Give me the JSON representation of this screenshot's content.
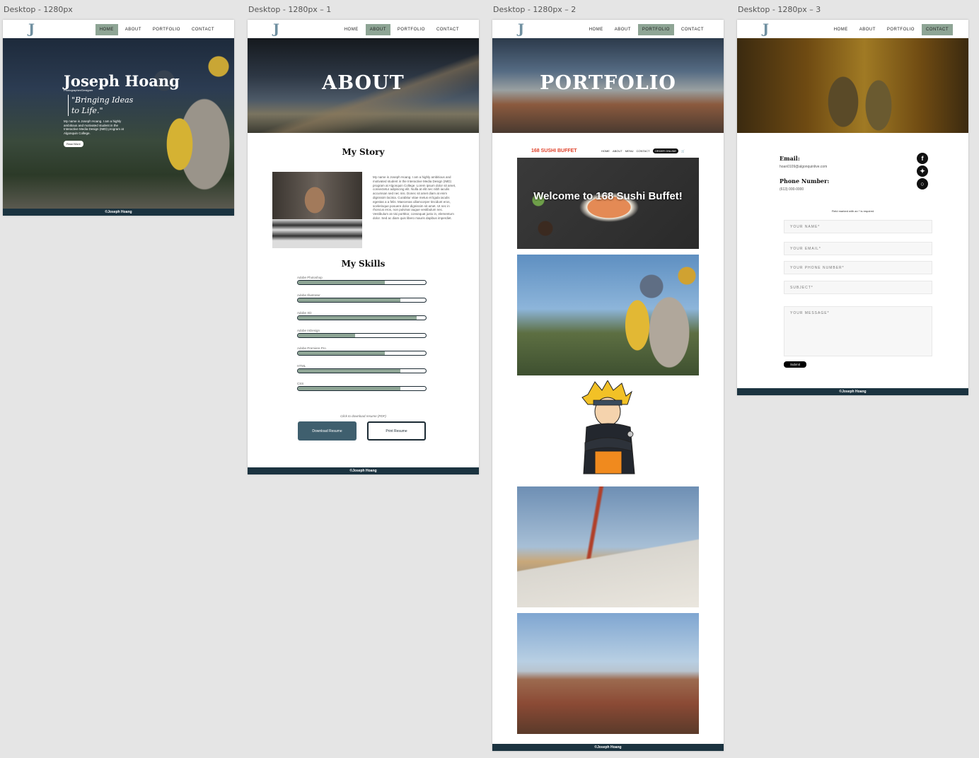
{
  "artboards": [
    {
      "label": "Desktop - 1280px"
    },
    {
      "label": "Desktop - 1280px – 1"
    },
    {
      "label": "Desktop - 1280px – 2"
    },
    {
      "label": "Desktop - 1280px – 3"
    }
  ],
  "nav": {
    "logo": "J",
    "home": "HOME",
    "about": "ABOUT",
    "portfolio": "PORTFOLIO",
    "contact": "CONTACT"
  },
  "footer": "©Joseph Hoang",
  "home": {
    "name": "Joseph Hoang",
    "role": "Photographer/Designer",
    "quote": "\"Bringing Ideas to Life.\"",
    "intro": "My name is Joseph Hoang. I am a highly ambitious and motivated student in the Interactive Media Design (IMD) program at Algonquin College.",
    "read_more": "Read More"
  },
  "about": {
    "title": "ABOUT",
    "story_title": "My Story",
    "story_text": "My name is Joseph Hoang. I am a highly ambitious and motivated student in the Interactive Media Design (IMD) program at Algonquin College. Lorem ipsum dolor sit amet, consectetur adipiscing elit. Nulla at elit nec nibh iaculis accumsan sed nec nisi. Donec sit amet diam at enim dignissim lacinia. Curabitur vitae metus et ligula iaculis egestas a a felis. Maecenas ullamcorper tincidunt eros, scelerisque posuere dolor dignissim sit amet. Ut nec in rhoncus eros, non pulvinar augue vestibulum nec. Vestibulum at nisi porttitor, consequat justo in, elementum dolor. Sed ac diam quis libero mauris dapibus imperdiet.",
    "skills_title": "My Skills",
    "skills": [
      {
        "name": "Adobe Photoshop",
        "level": 0.68
      },
      {
        "name": "Adobe Illustrator",
        "level": 0.8
      },
      {
        "name": "Adobe XD",
        "level": 0.93
      },
      {
        "name": "Adobe InDesign",
        "level": 0.45
      },
      {
        "name": "Adobe Premiere Pro",
        "level": 0.68
      },
      {
        "name": "HTML",
        "level": 0.8
      },
      {
        "name": "CSS",
        "level": 0.8
      }
    ],
    "resume_caption": "Click to download resume (PDF)",
    "download_button": "Download Resume",
    "print_button": "Print Resume"
  },
  "portfolio": {
    "title": "PORTFOLIO",
    "sushi": {
      "logo": "168 SUSHI BUFFET",
      "nav": [
        "HOME",
        "ABOUT",
        "MENU",
        "CONTACT"
      ],
      "order": "ORDER ONLINE",
      "headline": "Welcome to 168 Sushi Buffet!"
    }
  },
  "contact": {
    "email_label": "Email:",
    "email_value": "hoan0109@algonquinlive.com",
    "phone_label": "Phone Number:",
    "phone_value": "(613) 000-0000",
    "required_note": "Field marked with an * is required",
    "fields": [
      "YOUR NAME*",
      "YOUR EMAIL*",
      "YOUR PHONE NUMBER*",
      "SUBJECT*",
      "YOUR MESSAGE*"
    ],
    "submit": "Submit",
    "social_icons": [
      "facebook-icon",
      "twitter-icon",
      "instagram-icon"
    ]
  },
  "colors": {
    "accent": "#8ea595",
    "footer": "#1b3340",
    "primary_button": "#3f5f6e"
  }
}
